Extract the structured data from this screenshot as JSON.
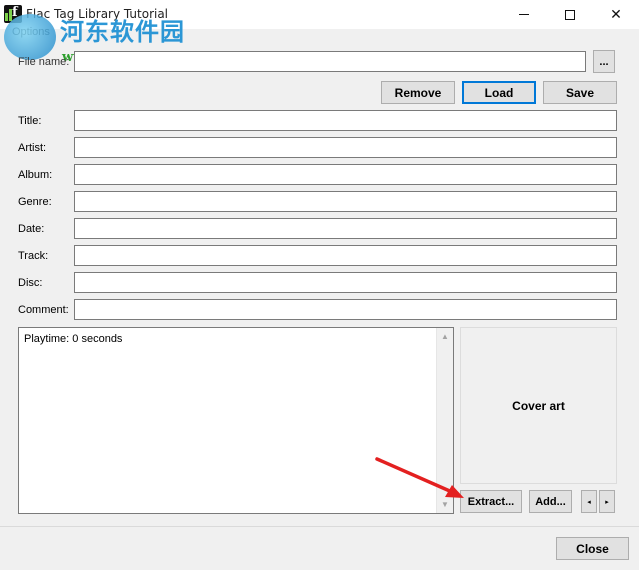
{
  "window": {
    "title": "Flac Tag Library Tutorial",
    "minimize": "minimize",
    "maximize": "maximize",
    "close": "✕"
  },
  "watermark": {
    "title": "河东软件园",
    "url": "www.pc0359.cn"
  },
  "menu": {
    "options": "Options"
  },
  "file": {
    "label": "File name:",
    "value": "",
    "browse": "..."
  },
  "actions": {
    "remove": "Remove",
    "load": "Load",
    "save": "Save"
  },
  "fields": [
    {
      "label": "Title:",
      "value": ""
    },
    {
      "label": "Artist:",
      "value": ""
    },
    {
      "label": "Album:",
      "value": ""
    },
    {
      "label": "Genre:",
      "value": ""
    },
    {
      "label": "Date:",
      "value": ""
    },
    {
      "label": "Track:",
      "value": ""
    },
    {
      "label": "Disc:",
      "value": ""
    },
    {
      "label": "Comment:",
      "value": ""
    }
  ],
  "info": {
    "playtime": "Playtime: 0 seconds"
  },
  "cover": {
    "label": "Cover art",
    "extract": "Extract...",
    "add": "Add...",
    "prev": "◂",
    "next": "▸"
  },
  "footer": {
    "close": "Close"
  },
  "annotation": {
    "arrow_color": "#e32020"
  }
}
